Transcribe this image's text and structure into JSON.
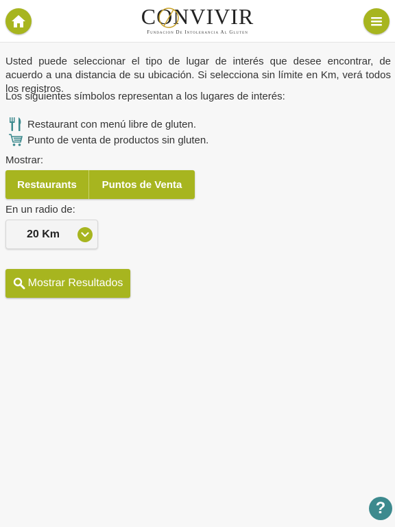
{
  "header": {
    "logo_title": "CONVIVIR",
    "logo_subtitle": "Fundacion De Intolerancia Al Gluten",
    "home_icon": "home-icon",
    "menu_icon": "hamburger-menu-icon",
    "accent_color": "#a7b51f"
  },
  "main": {
    "intro": "Usted puede seleccionar el tipo de lugar de interés que desee encontrar, de acuerdo a una distancia de su ubicación. Si selecciona sin límite en Km, verá todos los registros.",
    "symbols_title": "Los siguientes símbolos representan a los lugares de interés:",
    "symbols": [
      {
        "icon": "fork-knife-icon",
        "label": "Restaurant con menú libre de gluten."
      },
      {
        "icon": "shopping-cart-icon",
        "label": "Punto de venta de productos sin gluten."
      }
    ],
    "show_label": "Mostrar:",
    "filters": [
      {
        "label": "Restaurants"
      },
      {
        "label": "Puntos de Venta"
      }
    ],
    "radius_label": "En un radio de:",
    "radius_value": "20 Km",
    "search_button": "Mostrar Resultados"
  },
  "help": {
    "label": "?",
    "color": "#3d8a8e"
  }
}
